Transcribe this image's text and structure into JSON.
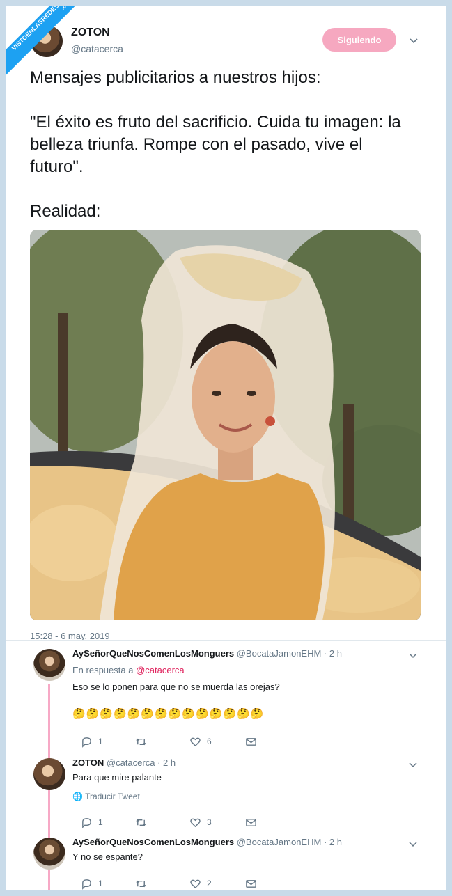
{
  "watermark": {
    "text": "VISTOENLASREDES",
    "sub": ".com"
  },
  "header": {
    "name": "ZOTON",
    "handle": "@catacerca",
    "follow_label": "Siguiendo"
  },
  "tweet": {
    "line1": "Mensajes publicitarios a nuestros hijos:",
    "line2": "\"El éxito es fruto del sacrificio. Cuida tu imagen: la belleza triunfa. Rompe con el pasado, vive el futuro\".",
    "line3": "Realidad:",
    "timestamp": "15:28 - 6 may. 2019"
  },
  "replies": [
    {
      "name": "AySeñorQueNosComenLosMonguers",
      "handle": "@BocataJamonEHM",
      "time": "· 2 h",
      "reply_to_prefix": "En respuesta a",
      "reply_to_user": "@catacerca",
      "text": "Eso se lo ponen para que no se muerda las orejas?",
      "emojis": "🤔🤔🤔🤔🤔🤔🤔🤔🤔🤔🤔🤔🤔🤔",
      "counts": {
        "replies": "1",
        "retweets": "",
        "likes": "6"
      }
    },
    {
      "name": "ZOTON",
      "handle": "@catacerca",
      "time": "· 2 h",
      "text": "Para que mire palante",
      "translate": "Traducir Tweet",
      "counts": {
        "replies": "1",
        "retweets": "",
        "likes": "3"
      }
    },
    {
      "name": "AySeñorQueNosComenLosMonguers",
      "handle": "@BocataJamonEHM",
      "time": "· 2 h",
      "text": "Y no se espante?",
      "counts": {
        "replies": "1",
        "retweets": "",
        "likes": "2"
      }
    }
  ],
  "colors": {
    "accent": "#1da1f2",
    "follow": "#f6a8c0",
    "thread": "#f7a9c6",
    "link": "#e0245e"
  }
}
